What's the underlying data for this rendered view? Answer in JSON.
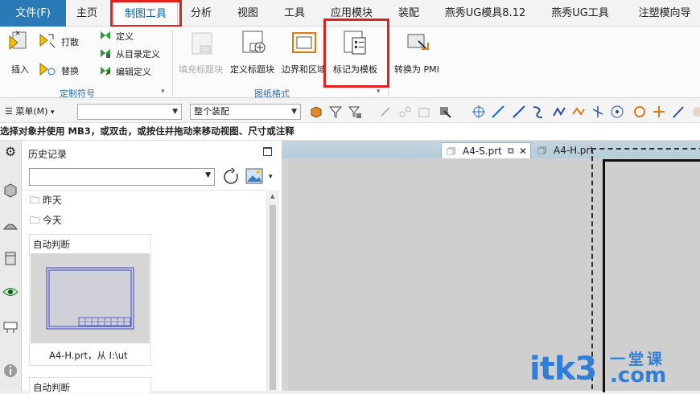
{
  "menubar": {
    "file": "文件(F)",
    "tabs": [
      "主页",
      "制图工具",
      "分析",
      "视图",
      "工具",
      "应用模块",
      "装配",
      "燕秀UG模具8.12",
      "燕秀UG工具",
      "注塑模向导"
    ]
  },
  "ribbon": {
    "custom_symbol": {
      "insert": "插入",
      "punch": "打散",
      "replace": "替换",
      "define": "定义",
      "define_from_catalog": "从目录定义",
      "edit_define": "编辑定义",
      "group": "定制符号"
    },
    "drawing_format": {
      "fill_title_block": "填充标题块",
      "define_title_block": "定义标题块",
      "borders_zones": "边界和区域",
      "mark_as_template": "标记为模板",
      "group": "图纸格式"
    },
    "convert_pmi": "转换为 PMI"
  },
  "toolbar": {
    "menu": "菜单(M)",
    "selection_filter": "",
    "scope": "整个装配"
  },
  "status": {
    "prompt": "选择对象并使用 MB3，或双击，或按住并拖动来移动视图、尺寸或注释"
  },
  "history": {
    "title": "历史记录",
    "search_value": "",
    "tree": [
      "昨天",
      "今天"
    ],
    "cards": [
      {
        "label": "自动判断",
        "caption": "A4-H.prt，从 I:\\ut"
      },
      {
        "label": "自动判断"
      }
    ]
  },
  "graphics": {
    "tabs": [
      "A4-S.prt",
      "A4-H.prt"
    ]
  },
  "watermark": {
    "brand": "itk3",
    "sub1": "一堂课",
    "sub2": ".com"
  },
  "colors": {
    "file_menu": "#2a7ab8",
    "active_tab": "#0b62a8",
    "highlight": "#e0211c",
    "group_label": "#2c6fb0"
  }
}
